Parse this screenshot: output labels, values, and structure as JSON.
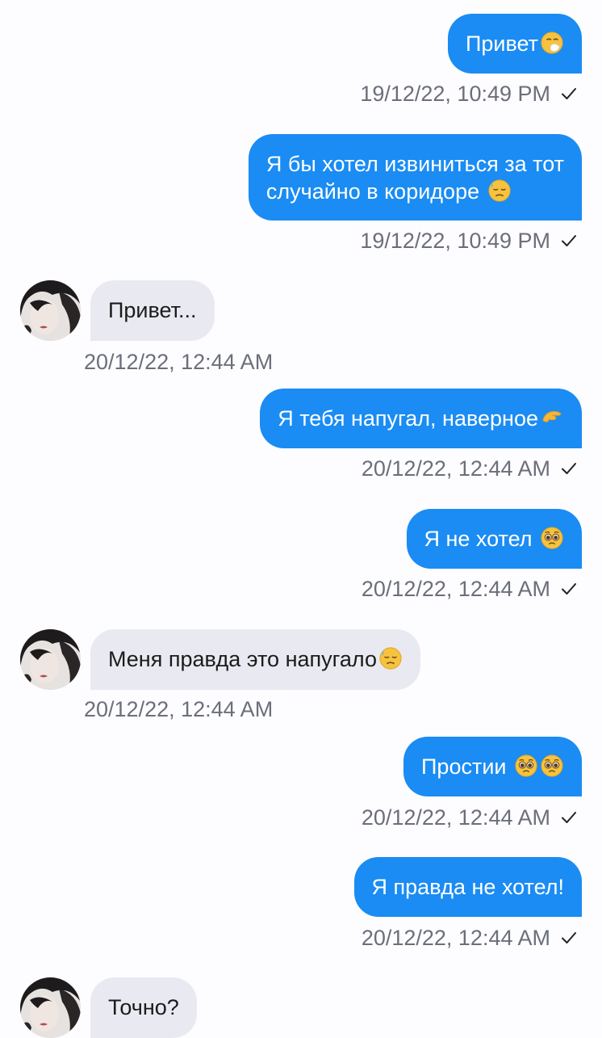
{
  "messages": [
    {
      "direction": "out",
      "text": "Привет",
      "emoji": [
        "sneezing-face"
      ],
      "time": "19/12/22, 10:49 PM",
      "read": true
    },
    {
      "direction": "out",
      "text_lines": [
        "Я бы хотел извиниться за тот",
        "случайно в коридоре "
      ],
      "emoji": [
        "downcast-sweat-face"
      ],
      "time": "19/12/22, 10:49 PM",
      "read": true
    },
    {
      "direction": "in",
      "text": "Привет...",
      "emoji": [],
      "time": "20/12/22, 12:44 AM"
    },
    {
      "direction": "out",
      "text": "Я тебя напугал, наверное",
      "emoji": [
        "pinching-hand"
      ],
      "time": "20/12/22, 12:44 AM",
      "read": true
    },
    {
      "direction": "out",
      "text": "Я не хотел ",
      "emoji": [
        "pleading-face"
      ],
      "time": "20/12/22, 12:44 AM",
      "read": true
    },
    {
      "direction": "in",
      "text": "Меня правда это напугало",
      "emoji": [
        "downcast-sweat-face"
      ],
      "time": "20/12/22, 12:44 AM"
    },
    {
      "direction": "out",
      "text": "Простии ",
      "emoji": [
        "pleading-face",
        "pleading-face"
      ],
      "time": "20/12/22, 12:44 AM",
      "read": true
    },
    {
      "direction": "out",
      "text": "Я правда не хотел!",
      "emoji": [],
      "time": "20/12/22, 12:44 AM",
      "read": true
    },
    {
      "direction": "in",
      "text": "Точно?",
      "emoji": []
    }
  ],
  "colors": {
    "outgoing_bubble": "#1a8cf3",
    "incoming_bubble": "#e9eaf1",
    "timestamp": "#6b6f7a",
    "background": "#fdfcfe"
  },
  "icons": {
    "read_receipt": "check-icon",
    "avatar": "contact-avatar-photo"
  }
}
